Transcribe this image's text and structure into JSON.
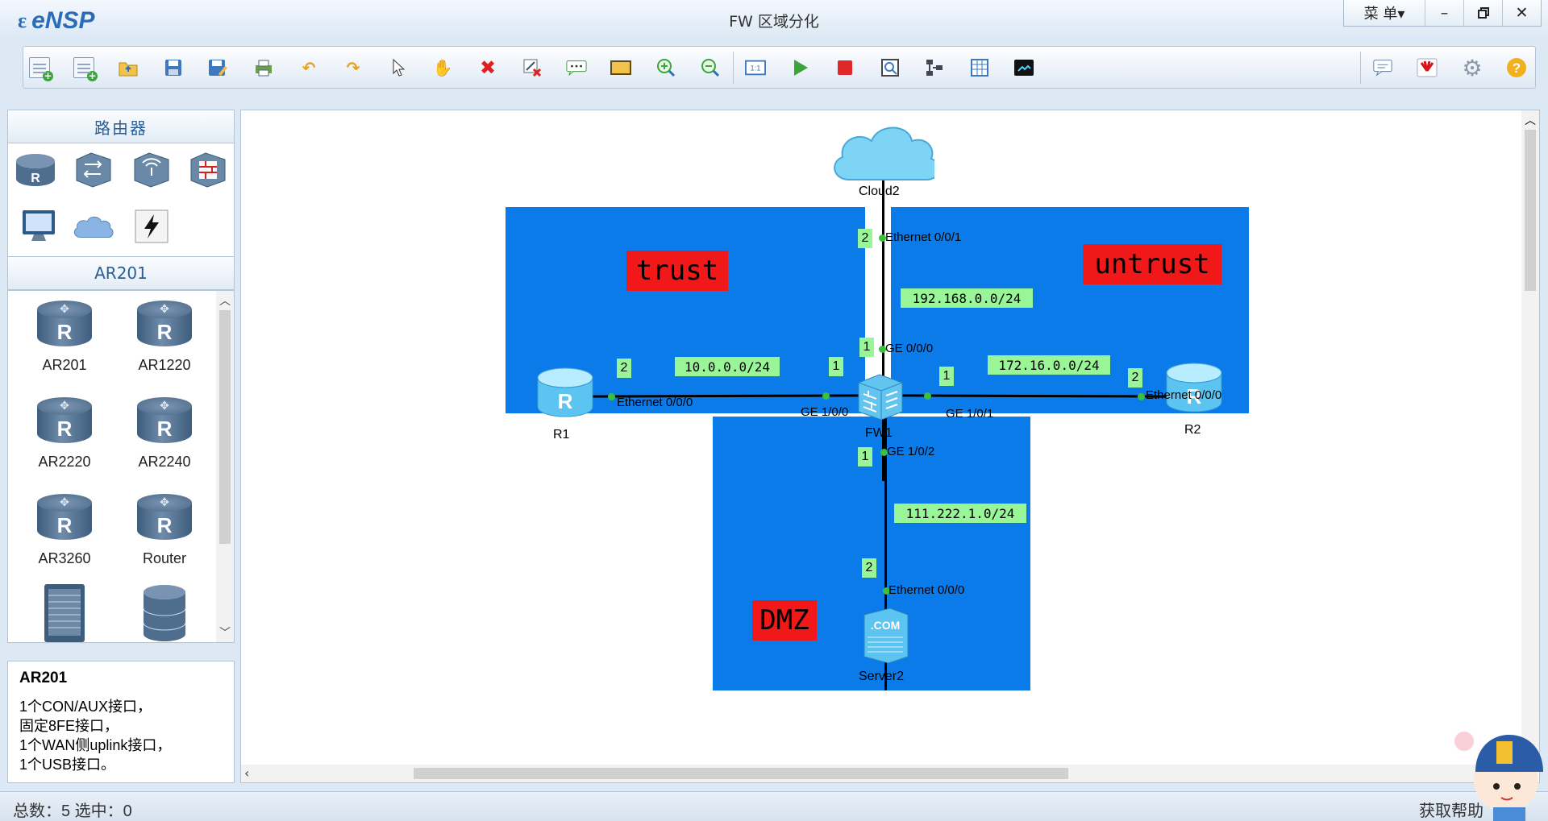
{
  "app": {
    "logo": "eNSP",
    "title": "FW 区域分化",
    "menu_label": "菜 单▾"
  },
  "window_controls": {
    "minimize": "–",
    "restore": "🗗",
    "close": "✕"
  },
  "toolbar": {
    "buttons": [
      "new-topology",
      "new-example",
      "open",
      "save",
      "save-as",
      "print",
      "undo",
      "redo",
      "select",
      "pan",
      "delete",
      "delete-link",
      "text",
      "rectangle",
      "zoom-in",
      "zoom-out",
      "fit",
      "start-device",
      "stop-device",
      "capture",
      "topology",
      "grid",
      "console"
    ],
    "right_buttons": [
      "comment",
      "huawei",
      "settings",
      "help"
    ]
  },
  "left_panel": {
    "category_title": "路由器",
    "categories": [
      "router-icon",
      "switch-icon",
      "wireless-icon",
      "firewall-icon",
      "pc-icon",
      "cloud-icon",
      "connection-icon"
    ],
    "subcategory_title": "AR201",
    "devices": [
      {
        "label": "AR201"
      },
      {
        "label": "AR1220"
      },
      {
        "label": "AR2220"
      },
      {
        "label": "AR2240"
      },
      {
        "label": "AR3260"
      },
      {
        "label": "Router"
      }
    ],
    "info": {
      "title": "AR201",
      "lines": [
        "1个CON/AUX接口，",
        "固定8FE接口，",
        "1个WAN侧uplink接口，",
        "1个USB接口。"
      ]
    }
  },
  "canvas": {
    "zones": {
      "trust": "trust",
      "untrust": "untrust",
      "dmz": "DMZ"
    },
    "networks": {
      "n1": "192.168.0.0/24",
      "n2": "10.0.0.0/24",
      "n3": "172.16.0.0/24",
      "n4": "111.222.1.0/24"
    },
    "devices": {
      "cloud": "Cloud2",
      "fw": "FW1",
      "r1": "R1",
      "r2": "R2",
      "server": "Server2"
    },
    "ports": {
      "cloud_eth": "Ethernet 0/0/1",
      "fw_ge000": "GE 0/0/0",
      "fw_ge100": "GE 1/0/0",
      "fw_ge101": "GE 1/0/1",
      "fw_ge102": "GE 1/0/2",
      "r1_eth": "Ethernet 0/0/0",
      "r2_eth": "Ethernet 0/0/0",
      "srv_eth": "Ethernet 0/0/0"
    },
    "numbers": {
      "cloud": "2",
      "fw_top": "1",
      "r1": "2",
      "fw_left": "1",
      "fw_right": "1",
      "r2": "2",
      "fw_bottom": "1",
      "server": "2"
    }
  },
  "status": {
    "left": "总数：5   选中：0",
    "right": "获取帮助"
  }
}
